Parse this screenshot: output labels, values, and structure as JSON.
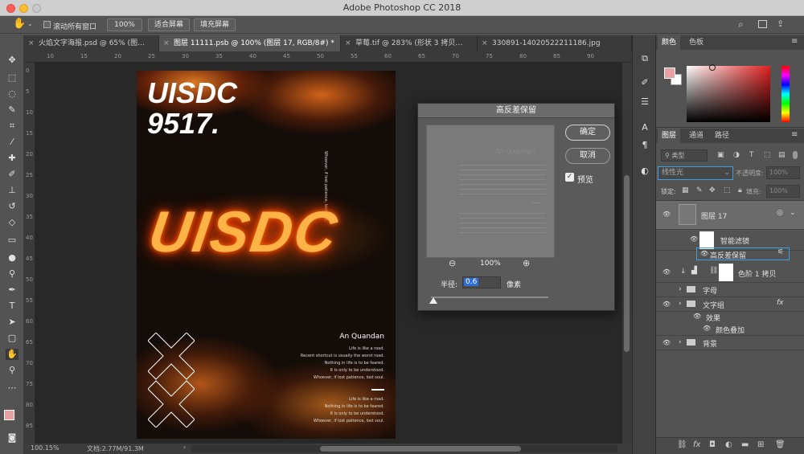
{
  "app": {
    "title": "Adobe Photoshop CC 2018"
  },
  "options_bar": {
    "scroll_all_label": "滚动所有窗口",
    "zoom_value": "100%",
    "fit_screen_label": "适合屏幕",
    "fill_screen_label": "填充屏幕"
  },
  "tabs": [
    {
      "label": "火焰文字海报.psd @ 65% (图…"
    },
    {
      "label": "图层 11111.psb @ 100% (图层 17, RGB/8#) *"
    },
    {
      "label": "草莓.tif @ 283% (形状 3 拷贝…"
    },
    {
      "label": "330891-14020522211186.jpg"
    }
  ],
  "ruler": {
    "top": [
      "10",
      "15",
      "20",
      "25",
      "30",
      "35",
      "40",
      "45",
      "50",
      "55",
      "60",
      "65",
      "70",
      "75",
      "80",
      "85",
      "90"
    ],
    "left": [
      "0",
      "5",
      "10",
      "15",
      "20",
      "25",
      "30",
      "35",
      "40",
      "45",
      "50",
      "55",
      "60",
      "65",
      "70",
      "75",
      "80",
      "85"
    ]
  },
  "poster": {
    "headline1": "UISDC",
    "headline2": "9517.",
    "fire_word": "UISDC",
    "vertical_text": "Whoever, if lost patience, lost soul.",
    "author": "An Quandan",
    "lines1": [
      "Life is like a road.",
      "Recent shortcut is usually the worst road.",
      "Nothing in life is to be feared.",
      "It is only to be understood.",
      "Whoever, if lost patience, lost soul."
    ],
    "lines2": [
      "Life is like a road.",
      "Nothing in life is to be feared.",
      "It is only to be understood.",
      "Whoever, if lost patience, lost soul."
    ]
  },
  "status": {
    "zoom": "100.15%",
    "doc": "文档:2.77M/91.3M"
  },
  "dialog": {
    "title": "高反差保留",
    "ok": "确定",
    "cancel": "取消",
    "preview_label": "预览",
    "preview_checked": true,
    "zoom": "100%",
    "radius_label": "半径:",
    "radius_value": "0.6",
    "unit": "像素",
    "slider_fraction": 0.02,
    "preview_author": "An Quandan"
  },
  "color_panel": {
    "tab_color": "颜色",
    "tab_swatches": "色板",
    "foreground": "#e8a1a0",
    "background": "#ffffff"
  },
  "layers_panel": {
    "tab_layers": "图层",
    "tab_channels": "通道",
    "tab_paths": "路径",
    "kind": "类型",
    "blend_mode": "线性光",
    "opacity_label": "不透明度:",
    "opacity_value": "100%",
    "lock_label": "锁定:",
    "fill_label": "填充:",
    "fill_value": "100%",
    "layers": [
      {
        "name": "图层 17"
      },
      {
        "name": "智能滤镜"
      },
      {
        "name": "高反差保留"
      },
      {
        "name": "色阶 1 拷贝"
      },
      {
        "name": "字母"
      },
      {
        "name": "文字组"
      },
      {
        "name": "效果"
      },
      {
        "name": "颜色叠加"
      },
      {
        "name": "背景"
      }
    ],
    "fx": "fx"
  },
  "colors": {
    "accent": "#3aa0e0",
    "selection": "#2d6fd6"
  }
}
